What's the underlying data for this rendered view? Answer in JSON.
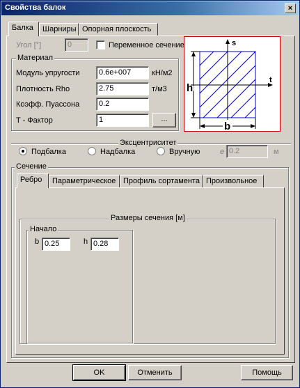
{
  "window": {
    "title": "Свойства балок",
    "close": "×"
  },
  "top_tabs": [
    "Балка",
    "Шарниры",
    "Опорная плоскость"
  ],
  "angle": {
    "label": "Угол [°]",
    "value": "0"
  },
  "variable_section": {
    "label": "Переменное сечение",
    "checked": false
  },
  "material": {
    "title": "Материал",
    "rows": [
      {
        "label": "Модуль упругости",
        "value": "0.6e+007",
        "unit": "кН/м2"
      },
      {
        "label": "Плотность Rho",
        "value": "2.75",
        "unit": "т/м3"
      },
      {
        "label": "Коэфф. Пуассона",
        "value": "0.2",
        "unit": ""
      },
      {
        "label": "T - Фактор",
        "value": "1",
        "unit": ""
      }
    ],
    "more_button": "..."
  },
  "diagram": {
    "axis_s": "s",
    "axis_t": "t",
    "dim_h": "h",
    "dim_b": "b",
    "border_color": "#cc0000",
    "line_color": "#0000cc"
  },
  "eccentricity": {
    "title": "Эксцентриситет",
    "options": [
      {
        "label": "Подбалка",
        "checked": true
      },
      {
        "label": "Надбалка",
        "checked": false
      },
      {
        "label": "Вручную",
        "checked": false
      }
    ],
    "e_label": "e",
    "e_value": "0.2",
    "e_unit": "м"
  },
  "section": {
    "title": "Сечение",
    "tabs": [
      "Ребро",
      "Параметрическое",
      "Профиль сортамента",
      "Произвольное"
    ],
    "dims_title": "Размеры сечения [м]",
    "start": {
      "title": "Начало",
      "b_label": "b",
      "b_value": "0.25",
      "h_label": "h",
      "h_value": "0.28"
    }
  },
  "buttons": {
    "ok": "OK",
    "cancel": "Отменить",
    "help": "Помощь"
  }
}
